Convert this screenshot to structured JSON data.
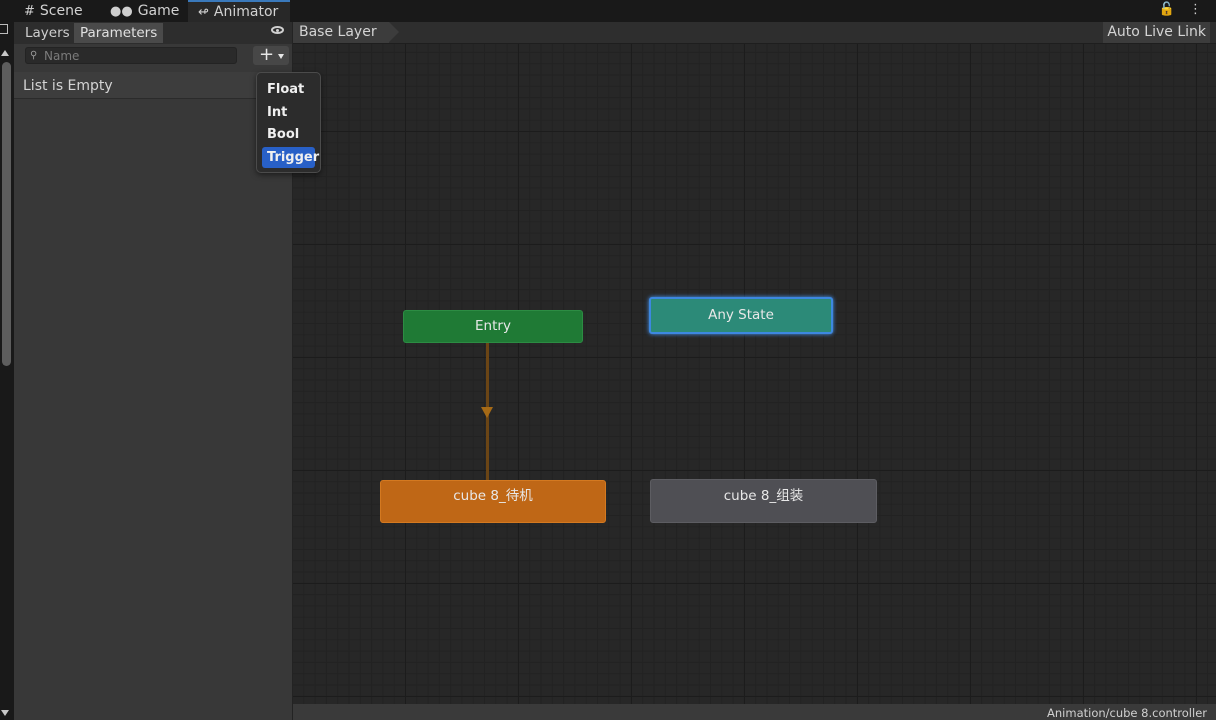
{
  "tabs": [
    {
      "label": "Scene",
      "icon": "hash-icon"
    },
    {
      "label": "Game",
      "icon": "gamepad-icon"
    },
    {
      "label": "Animator",
      "icon": "animator-icon"
    }
  ],
  "tabbar_right": {
    "lock_icon": "lock-icon",
    "menu_icon": "kebab-icon"
  },
  "left_panel": {
    "tabs": [
      "Layers",
      "Parameters"
    ],
    "selected_tab": "Parameters",
    "eye_icon": "eye-icon",
    "search": {
      "placeholder": "Name",
      "value": ""
    },
    "add_button": "+",
    "list_empty_text": "List is Empty"
  },
  "dropdown": {
    "items": [
      "Float",
      "Int",
      "Bool",
      "Trigger"
    ],
    "selected": "Trigger"
  },
  "graph": {
    "breadcrumb": "Base Layer",
    "auto_live_link": "Auto Live Link",
    "states": {
      "entry": "Entry",
      "any_state": "Any State",
      "idle": "cube 8_待机",
      "assemble": "cube 8_组装"
    }
  },
  "status": {
    "path": "Animation/cube 8.controller"
  },
  "colors": {
    "entry": "#1f7a35",
    "any_state": "#2c8a78",
    "default_state": "#bf6716",
    "state": "#4f4f54",
    "selection": "#2860c7"
  }
}
